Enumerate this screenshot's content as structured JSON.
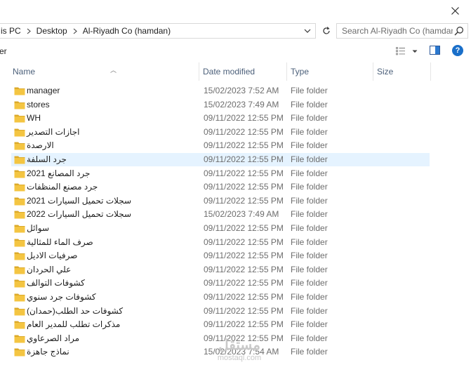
{
  "address": {
    "crumbs": [
      "is PC",
      "Desktop",
      "Al-Riyadh Co (hamdan)"
    ]
  },
  "search": {
    "placeholder": "Search Al-Riyadh Co (hamdan)"
  },
  "toolbar": {
    "label": "er"
  },
  "help": {
    "label": "?"
  },
  "columns": {
    "name": "Name",
    "date": "Date modified",
    "type": "Type",
    "size": "Size"
  },
  "rows": [
    {
      "name": "manager",
      "date": "15/02/2023 7:52 AM",
      "type": "File folder"
    },
    {
      "name": "stores",
      "date": "15/02/2023 7:49 AM",
      "type": "File folder"
    },
    {
      "name": "WH",
      "date": "09/11/2022 12:55 PM",
      "type": "File folder"
    },
    {
      "name": "اجازات التصدير",
      "date": "09/11/2022 12:55 PM",
      "type": "File folder"
    },
    {
      "name": "الارصدة",
      "date": "09/11/2022 12:55 PM",
      "type": "File folder"
    },
    {
      "name": "جرد السلفة",
      "date": "09/11/2022 12:55 PM",
      "type": "File folder"
    },
    {
      "name": "جرد المصانع 2021",
      "date": "09/11/2022 12:55 PM",
      "type": "File folder"
    },
    {
      "name": "جرد مصنع المنظفات",
      "date": "09/11/2022 12:55 PM",
      "type": "File folder"
    },
    {
      "name": "سجلات تحميل السيارات 2021",
      "date": "09/11/2022 12:55 PM",
      "type": "File folder"
    },
    {
      "name": "سجلات تحميل السيارات 2022",
      "date": "15/02/2023 7:49 AM",
      "type": "File folder"
    },
    {
      "name": "سوائل",
      "date": "09/11/2022 12:55 PM",
      "type": "File folder"
    },
    {
      "name": "صرف الماء للمثالية",
      "date": "09/11/2022 12:55 PM",
      "type": "File folder"
    },
    {
      "name": "صرفيات الاديل",
      "date": "09/11/2022 12:55 PM",
      "type": "File folder"
    },
    {
      "name": "علي الحردان",
      "date": "09/11/2022 12:55 PM",
      "type": "File folder"
    },
    {
      "name": "كشوفات التوالف",
      "date": "09/11/2022 12:55 PM",
      "type": "File folder"
    },
    {
      "name": "كشوفات جرد سنوي",
      "date": "09/11/2022 12:55 PM",
      "type": "File folder"
    },
    {
      "name": "كشوفات حد الطلب(حمدان)",
      "date": "09/11/2022 12:55 PM",
      "type": "File folder"
    },
    {
      "name": "مذكرات تطلب للمدير العام",
      "date": "09/11/2022 12:55 PM",
      "type": "File folder"
    },
    {
      "name": "مراد الصرعاوي",
      "date": "09/11/2022 12:55 PM",
      "type": "File folder"
    },
    {
      "name": "نماذج جاهزة",
      "date": "15/02/2023 7:54 AM",
      "type": "File folder"
    }
  ],
  "selected_row": 5,
  "colors": {
    "folder": "#f4c542",
    "folder_dark": "#dcaa2a",
    "selection": "#e5f3ff",
    "header_text": "#4c607a",
    "help_blue": "#1a6fc9"
  },
  "watermark": {
    "main": "مستقل",
    "sub": "mostaql.com"
  }
}
